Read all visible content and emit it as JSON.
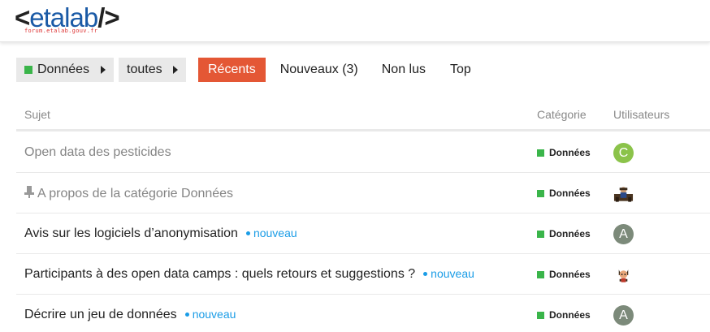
{
  "header": {
    "logo_text": "etalab",
    "logo_subtext": "forum.etalab.gouv.fr"
  },
  "nav": {
    "category_label": "Données",
    "category_color": "#3ab54a",
    "subcategory_label": "toutes",
    "tabs": [
      {
        "label": "Récents",
        "active": true
      },
      {
        "label": "Nouveaux (3)",
        "active": false
      },
      {
        "label": "Non lus",
        "active": false
      },
      {
        "label": "Top",
        "active": false
      }
    ]
  },
  "table": {
    "headers": {
      "subject": "Sujet",
      "category": "Catégorie",
      "users": "Utilisateurs"
    },
    "rows": [
      {
        "title": "Open data des pesticides",
        "visited": true,
        "pinned": false,
        "badge": "",
        "category": "Données",
        "avatar_letter": "C",
        "avatar_color": "#8bc34a"
      },
      {
        "title": "A propos de la catégorie Données",
        "visited": true,
        "pinned": true,
        "badge": "",
        "category": "Données",
        "avatar_letter": "",
        "avatar_icon": "user-photo-icon"
      },
      {
        "title": "Avis sur les logiciels d’anonymisation",
        "visited": false,
        "pinned": false,
        "badge": "nouveau",
        "category": "Données",
        "avatar_letter": "A",
        "avatar_color": "#7c8a7a"
      },
      {
        "title": "Participants à des open data camps : quels retours et suggestions ?",
        "visited": false,
        "pinned": false,
        "badge": "nouveau",
        "category": "Données",
        "avatar_letter": "",
        "avatar_icon": "octocat-avatar-icon"
      },
      {
        "title": "Décrire un jeu de données",
        "visited": false,
        "pinned": false,
        "badge": "nouveau",
        "category": "Données",
        "avatar_letter": "A",
        "avatar_color": "#7c8a7a"
      }
    ]
  }
}
